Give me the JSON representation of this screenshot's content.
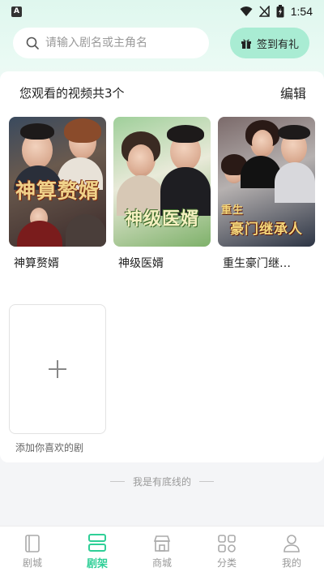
{
  "status_bar": {
    "time": "1:54",
    "notification_icon": "A"
  },
  "search": {
    "placeholder": "请输入剧名或主角名"
  },
  "signin_button": {
    "label": "签到有礼"
  },
  "shelf": {
    "summary": "您观看的视频共3个",
    "edit_label": "编辑",
    "items": [
      {
        "title": "神算赘婿",
        "poster_text": "神算赘婿"
      },
      {
        "title": "神级医婿",
        "poster_text": "神级医婿"
      },
      {
        "title": "重生豪门继…",
        "poster_text_small": "重生",
        "poster_text": "豪门继承人"
      }
    ],
    "add_label": "添加你喜欢的剧",
    "end_text": "我是有底线的"
  },
  "tabs": [
    {
      "label": "剧城",
      "icon": "book-icon",
      "active": false
    },
    {
      "label": "剧架",
      "icon": "shelf-icon",
      "active": true
    },
    {
      "label": "商城",
      "icon": "store-icon",
      "active": false
    },
    {
      "label": "分类",
      "icon": "category-icon",
      "active": false
    },
    {
      "label": "我的",
      "icon": "profile-icon",
      "active": false
    }
  ],
  "colors": {
    "accent": "#2fcf97",
    "signin_bg": "#a9ecd3",
    "header_bg": "#dff7ee"
  }
}
